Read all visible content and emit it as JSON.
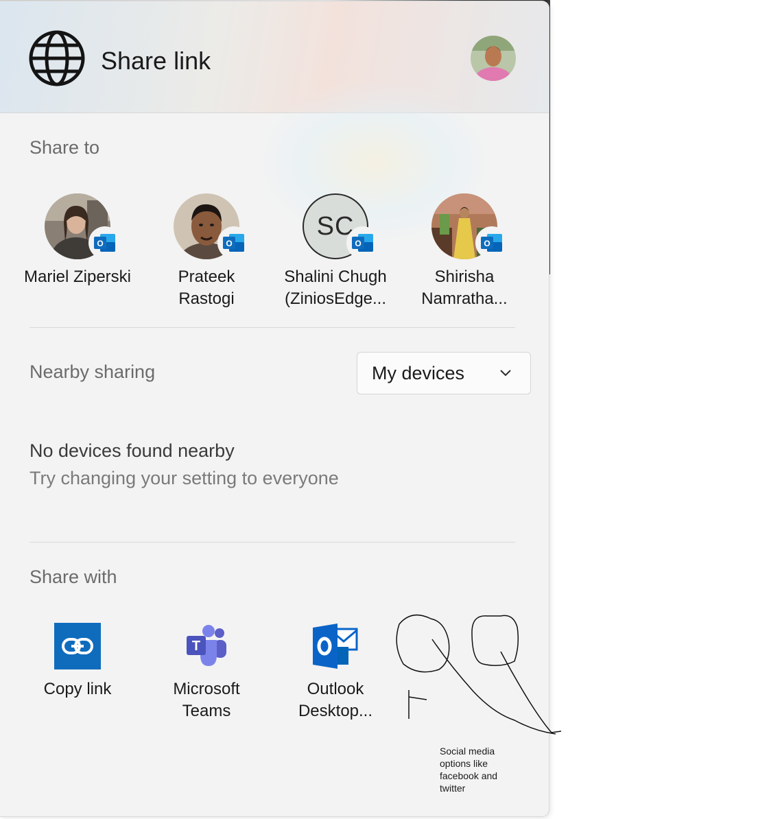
{
  "header": {
    "title": "Share link",
    "globe_icon": "globe-icon",
    "account_avatar": "profile-photo"
  },
  "share_to": {
    "title": "Share to",
    "contacts": [
      {
        "name": "Mariel Ziperski",
        "avatar": "photo",
        "badge": "outlook-icon"
      },
      {
        "name": "Prateek Rastogi",
        "avatar": "photo",
        "badge": "outlook-icon"
      },
      {
        "name": "Shalini Chugh (ZiniosEdge...",
        "initials": "SC",
        "badge": "outlook-icon"
      },
      {
        "name": "Shirisha Namratha...",
        "avatar": "photo",
        "badge": "outlook-icon"
      }
    ]
  },
  "nearby": {
    "title": "Nearby sharing",
    "dropdown_value": "My devices",
    "empty_title": "No devices found nearby",
    "empty_subtitle": "Try changing your setting to everyone"
  },
  "share_with": {
    "title": "Share with",
    "apps": [
      {
        "name": "Copy link",
        "icon": "link-icon",
        "color": "#0f6cbd"
      },
      {
        "name": "Microsoft Teams",
        "icon": "teams-icon",
        "color": "#5b5fc7"
      },
      {
        "name": "Outlook Desktop...",
        "icon": "outlook-icon",
        "color": "#0a64c8"
      }
    ]
  },
  "annotation": {
    "note": "Social media options like facebook and twitter"
  },
  "colors": {
    "accent": "#0f6cbd",
    "panel_bg": "#f3f3f3",
    "section_title": "#6b6b6b"
  }
}
